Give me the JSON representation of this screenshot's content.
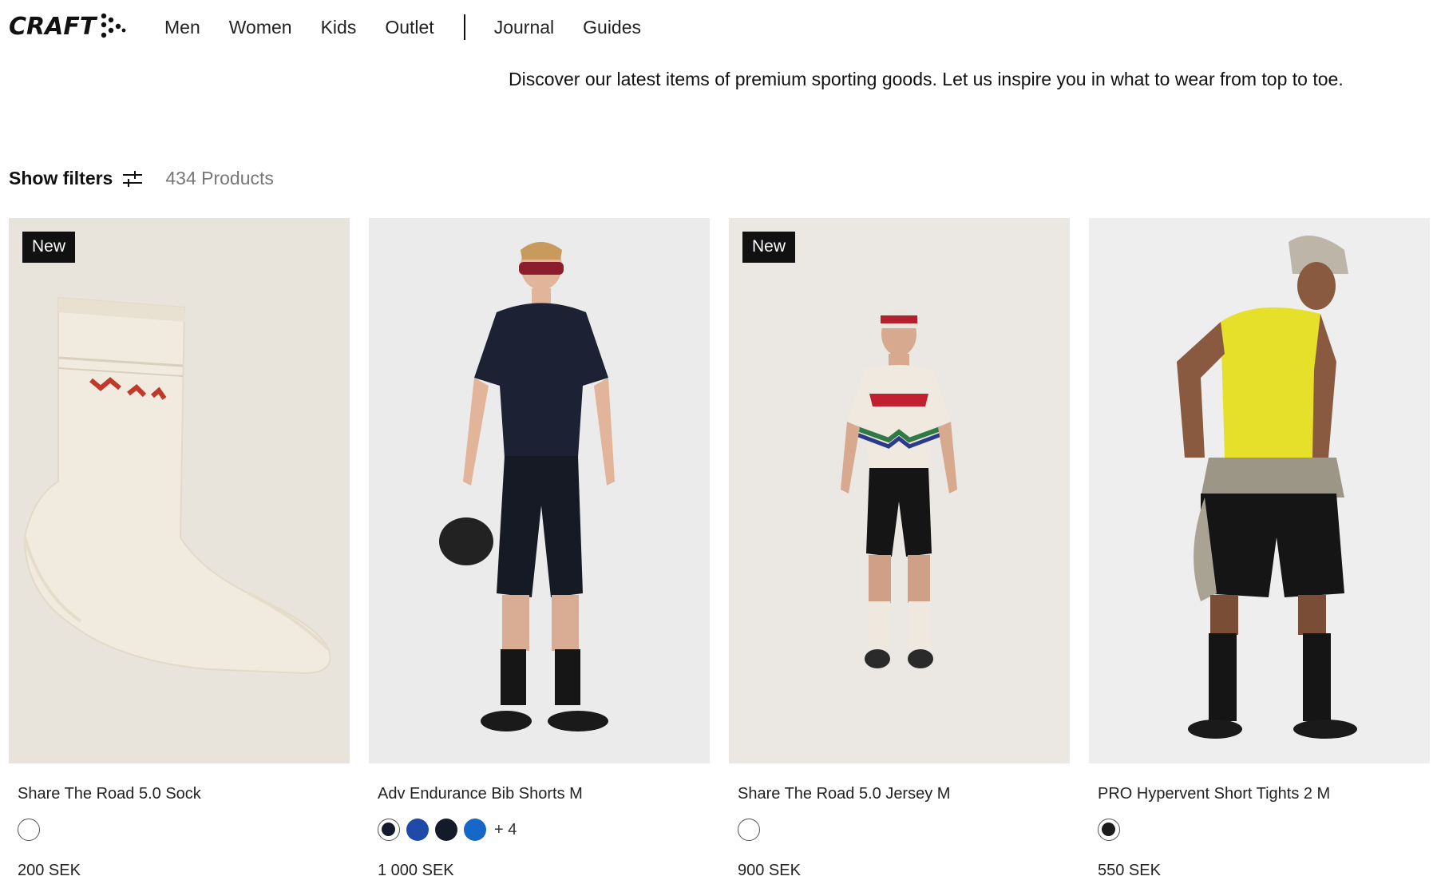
{
  "brand": {
    "name": "CRAFT"
  },
  "nav": {
    "items": [
      {
        "label": "Men"
      },
      {
        "label": "Women"
      },
      {
        "label": "Kids"
      },
      {
        "label": "Outlet"
      },
      {
        "label": "Journal"
      },
      {
        "label": "Guides"
      }
    ]
  },
  "intro": {
    "text": "Discover our latest items of premium sporting goods. Let us inspire you in what to wear from top to toe."
  },
  "toolbar": {
    "show_filters_label": "Show filters",
    "filter_icon": "sliders-icon",
    "product_count": "434 Products"
  },
  "products": [
    {
      "badge": "New",
      "name": "Share The Road 5.0 Sock",
      "price": "200 SEK",
      "image_bg": "#e8e4dc",
      "swatches": [
        {
          "color": "#ffffff",
          "selected": true
        }
      ],
      "more_colors": ""
    },
    {
      "badge": "",
      "name": "Adv Endurance Bib Shorts M",
      "price": "1 000 SEK",
      "image_bg": "#ebebeb",
      "swatches": [
        {
          "color": "#141a2b",
          "selected": true
        },
        {
          "color": "#1f4aa8",
          "selected": false
        },
        {
          "color": "#151a2a",
          "selected": false
        },
        {
          "color": "#1668c8",
          "selected": false
        }
      ],
      "more_colors": "+ 4"
    },
    {
      "badge": "New",
      "name": "Share The Road 5.0 Jersey M",
      "price": "900 SEK",
      "image_bg": "#ebe8e3",
      "swatches": [
        {
          "color": "#ffffff",
          "selected": true
        }
      ],
      "more_colors": ""
    },
    {
      "badge": "",
      "name": "PRO Hypervent Short Tights 2 M",
      "price": "550 SEK",
      "image_bg": "#eeeeee",
      "swatches": [
        {
          "color": "#1b1b1b",
          "selected": true
        }
      ],
      "more_colors": ""
    }
  ]
}
